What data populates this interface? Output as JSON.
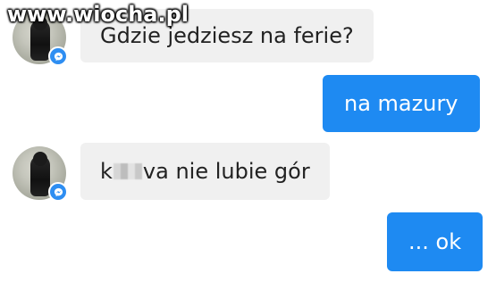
{
  "watermark": "www.wiocha.pl",
  "messages": [
    {
      "direction": "incoming",
      "text": "Gdzie jedziesz na ferie?"
    },
    {
      "direction": "outgoing",
      "text": "na mazury"
    },
    {
      "direction": "incoming",
      "text_before": "k",
      "text_after": "va nie lubie gór"
    },
    {
      "direction": "outgoing",
      "text": "... ok"
    }
  ],
  "colors": {
    "outgoing_bubble": "#1e8af2",
    "incoming_bubble": "#f0f0f0",
    "messenger_badge": "#2e8ef2"
  },
  "icons": {
    "avatar_badge": "messenger-icon"
  }
}
